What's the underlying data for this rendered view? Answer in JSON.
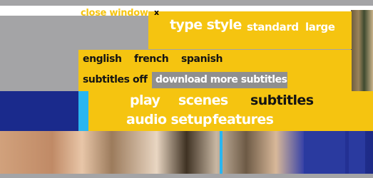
{
  "header": {
    "close_window_label": "close window",
    "close_icon_glyph": "x"
  },
  "type_style": {
    "label": "type style",
    "options": [
      "standard",
      "large"
    ]
  },
  "language": {
    "options": [
      "english",
      "french",
      "spanish"
    ]
  },
  "subtitles_panel": {
    "off_label": "subtitles off",
    "download_label": "download more subtitles"
  },
  "main_menu": {
    "play": "play",
    "scenes": "scenes",
    "subtitles": "subtitles",
    "audio_setup": "audio setup",
    "features": "features"
  },
  "colors": {
    "panel_yellow": "#f5c410",
    "selected_text": "#141414",
    "menu_text": "#ffffff",
    "download_bg": "#8f8f8f",
    "accent_blue": "#29b6f0",
    "navy": "#1a2a8c"
  }
}
